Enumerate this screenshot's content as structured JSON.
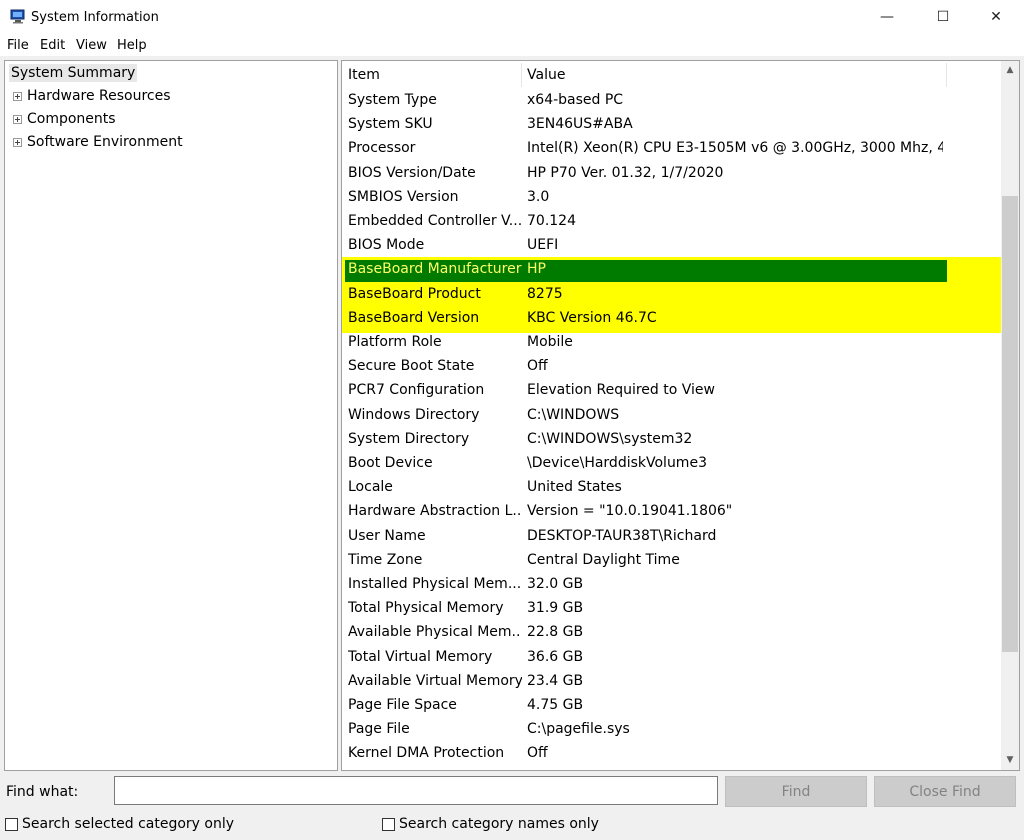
{
  "window": {
    "title": "System Information",
    "min_glyph": "—",
    "max_glyph": "☐",
    "close_glyph": "✕"
  },
  "menu": [
    "File",
    "Edit",
    "View",
    "Help"
  ],
  "tree": {
    "root": "System Summary",
    "children": [
      "Hardware Resources",
      "Components",
      "Software Environment"
    ]
  },
  "table": {
    "headers": [
      "Item",
      "Value"
    ],
    "rows": [
      [
        "System Type",
        "x64-based PC"
      ],
      [
        "System SKU",
        "3EN46US#ABA"
      ],
      [
        "Processor",
        "Intel(R) Xeon(R) CPU E3-1505M v6 @ 3.00GHz, 3000 Mhz, 4..."
      ],
      [
        "BIOS Version/Date",
        "HP P70 Ver. 01.32, 1/7/2020"
      ],
      [
        "SMBIOS Version",
        "3.0"
      ],
      [
        "Embedded Controller V...",
        "70.124"
      ],
      [
        "BIOS Mode",
        "UEFI"
      ],
      [
        "BaseBoard Manufacturer",
        "HP"
      ],
      [
        "BaseBoard Product",
        "8275"
      ],
      [
        "BaseBoard Version",
        "KBC Version 46.7C"
      ],
      [
        "Platform Role",
        "Mobile"
      ],
      [
        "Secure Boot State",
        "Off"
      ],
      [
        "PCR7 Configuration",
        "Elevation Required to View"
      ],
      [
        "Windows Directory",
        "C:\\WINDOWS"
      ],
      [
        "System Directory",
        "C:\\WINDOWS\\system32"
      ],
      [
        "Boot Device",
        "\\Device\\HarddiskVolume3"
      ],
      [
        "Locale",
        "United States"
      ],
      [
        "Hardware Abstraction L...",
        "Version = \"10.0.19041.1806\""
      ],
      [
        "User Name",
        "DESKTOP-TAUR38T\\Richard"
      ],
      [
        "Time Zone",
        "Central Daylight Time"
      ],
      [
        "Installed Physical Mem...",
        "32.0 GB"
      ],
      [
        "Total Physical Memory",
        "31.9 GB"
      ],
      [
        "Available Physical Mem...",
        "22.8 GB"
      ],
      [
        "Total Virtual Memory",
        "36.6 GB"
      ],
      [
        "Available Virtual Memory",
        "23.4 GB"
      ],
      [
        "Page File Space",
        "4.75 GB"
      ],
      [
        "Page File",
        "C:\\pagefile.sys"
      ],
      [
        "Kernel DMA Protection",
        "Off"
      ]
    ],
    "selected_row": 7,
    "highlight_color": "#ffff00",
    "selection_color": "#007b00"
  },
  "scrollbar": {
    "up_glyph": "▲",
    "down_glyph": "▼"
  },
  "find": {
    "label": "Find what:",
    "value": "",
    "find_button": "Find",
    "close_find_button": "Close Find",
    "checkbox_selected": "Search selected category only",
    "checkbox_names": "Search category names only"
  }
}
